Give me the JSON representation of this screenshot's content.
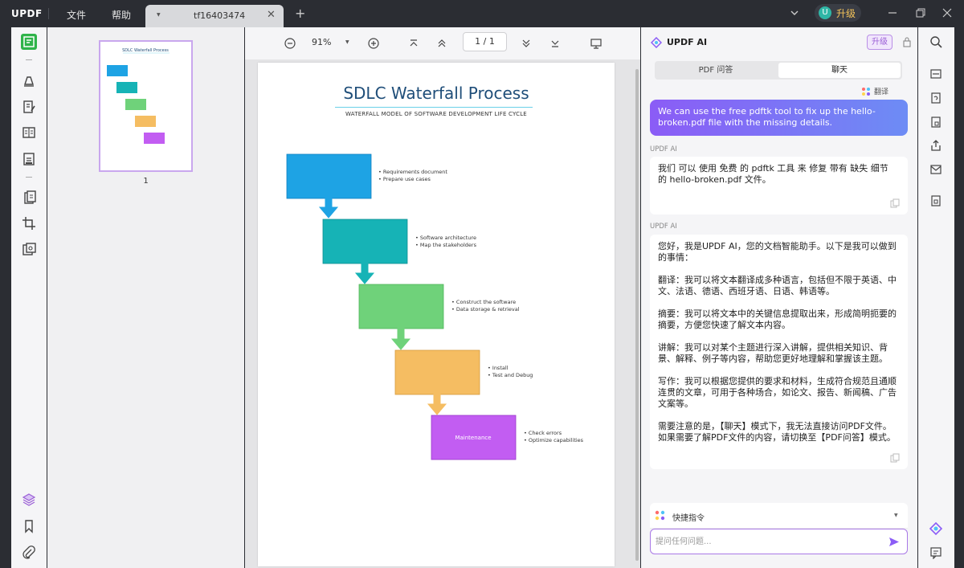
{
  "app": {
    "logo": "UPDF",
    "menu": [
      "文件",
      "帮助"
    ],
    "tab_label": "tf16403474",
    "upgrade_avatar": "U",
    "upgrade_label": "升级"
  },
  "thumbnails": {
    "page_number": "1"
  },
  "toolbar": {
    "zoom": "91%",
    "page_indicator": "1 / 1"
  },
  "document": {
    "title": "SDLC Waterfall Process",
    "subtitle": "WATERFALL MODEL OF SOFTWARE DEVELOPMENT LIFE CYCLE",
    "steps": [
      {
        "label": "",
        "color": "#1ea3e4",
        "bullets": [
          "Requirements document",
          "Prepare use cases"
        ]
      },
      {
        "label": "",
        "color": "#16b3b6",
        "bullets": [
          "Software architecture",
          "Map the stakeholders"
        ]
      },
      {
        "label": "",
        "color": "#6fd27a",
        "bullets": [
          "Construct the software",
          "Data storage & retrieval"
        ]
      },
      {
        "label": "",
        "color": "#f5bd62",
        "bullets": [
          "Install",
          "Test and Debug"
        ]
      },
      {
        "label": "Maintenance",
        "color": "#c25df2",
        "bullets": [
          "Check errors",
          "Optimize capabilities"
        ]
      }
    ]
  },
  "ai": {
    "title": "UPDF AI",
    "upgrade": "升级",
    "tabs": [
      "PDF 问答",
      "聊天"
    ],
    "translate": "翻译",
    "user_message": "We can use the free pdftk tool to fix up the hello-broken.pdf file with the missing details.",
    "responses": [
      {
        "label": "UPDF AI",
        "paragraphs": [
          "我们 可以 使用 免费 的 pdftk 工具 来 修复 带有 缺失 细节 的 hello-broken.pdf 文件。"
        ]
      },
      {
        "label": "UPDF AI",
        "paragraphs": [
          "您好，我是UPDF AI，您的文档智能助手。以下是我可以做到的事情：",
          "翻译：我可以将文本翻译成多种语言，包括但不限于英语、中文、法语、德语、西班牙语、日语、韩语等。",
          "摘要：我可以将文本中的关键信息提取出来，形成简明扼要的摘要，方便您快速了解文本内容。",
          "讲解：我可以对某个主题进行深入讲解，提供相关知识、背景、解释、例子等内容，帮助您更好地理解和掌握该主题。",
          "写作：我可以根据您提供的要求和材料，生成符合规范且通顺连贯的文章，可用于各种场合，如论文、报告、新闻稿、广告文案等。",
          "需要注意的是，【聊天】模式下，我无法直接访问PDF文件。如果需要了解PDF文件的内容，请切换至【PDF问答】模式。"
        ]
      }
    ],
    "quick_commands": "快捷指令",
    "input_placeholder": "提问任何问题..."
  }
}
